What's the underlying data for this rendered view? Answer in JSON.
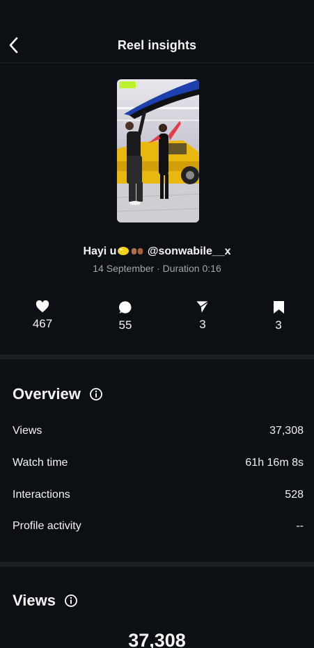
{
  "header": {
    "title": "Reel insights",
    "back_icon": "chevron-left-icon"
  },
  "reel": {
    "caption_prefix": "Hayi u",
    "caption_mention": "@sonwabile__x",
    "date": "14 September",
    "duration": "Duration 0:16",
    "separator": "·"
  },
  "stats": [
    {
      "icon": "heart-icon",
      "value": "467"
    },
    {
      "icon": "comment-icon",
      "value": "55"
    },
    {
      "icon": "share-icon",
      "value": "3"
    },
    {
      "icon": "bookmark-icon",
      "value": "3"
    }
  ],
  "overview": {
    "title": "Overview",
    "rows": [
      {
        "label": "Views",
        "value": "37,308"
      },
      {
        "label": "Watch time",
        "value": "61h 16m 8s"
      },
      {
        "label": "Interactions",
        "value": "528"
      },
      {
        "label": "Profile activity",
        "value": "--"
      }
    ]
  },
  "views": {
    "title": "Views",
    "total": "37,308"
  },
  "colors": {
    "background": "#0c0f14",
    "divider": "#1b1e23",
    "muted_text": "#a3a8ae"
  }
}
